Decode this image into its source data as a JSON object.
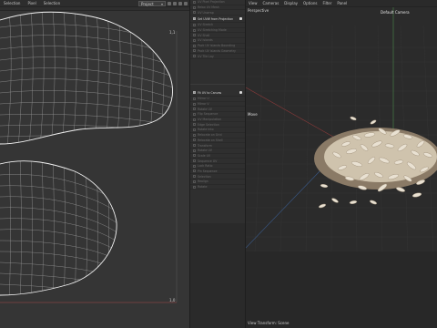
{
  "uv_editor": {
    "menu": [
      "Selection",
      "Pixel",
      "Selection"
    ],
    "project_select": "Project",
    "coord_top": "1,1",
    "coord_bottom": "1,0"
  },
  "tools_panel": {
    "top_items": [
      "UV Pixel Projection",
      "Relax UV Mesh",
      "UV Unwrap",
      "Set UVW from Projection",
      "UV Stretch",
      "UV Stretching Mode",
      "UV Shell",
      "UV Islands",
      "Pack UV Islands Bounding",
      "Pack UV Islands Geometry",
      "UV Tile Lay"
    ],
    "highlight_top_index": 3,
    "bottom_items": [
      "Fit UV to Canvas",
      "Mirror U",
      "Mirror V",
      "Rotate UV",
      "Flip Sequence",
      "UV Manipulation",
      "Edge Selection",
      "Rotate Into",
      "Relocate on Grid",
      "Relocate on Shell",
      "Transform",
      "Rotate UV",
      "Scale UV",
      "Sequence UV",
      "Lock Ratio",
      "Pin Sequence",
      "Selection",
      "Realign",
      "Rotate"
    ],
    "highlight_bottom_index": 0
  },
  "viewport": {
    "menu": [
      "View",
      "Cameras",
      "Display",
      "Options",
      "Filter",
      "Panel"
    ],
    "camera_label": "Perspective",
    "default_camera": "Default Camera",
    "move_label": "Move",
    "status": "View Transform: Scene"
  }
}
